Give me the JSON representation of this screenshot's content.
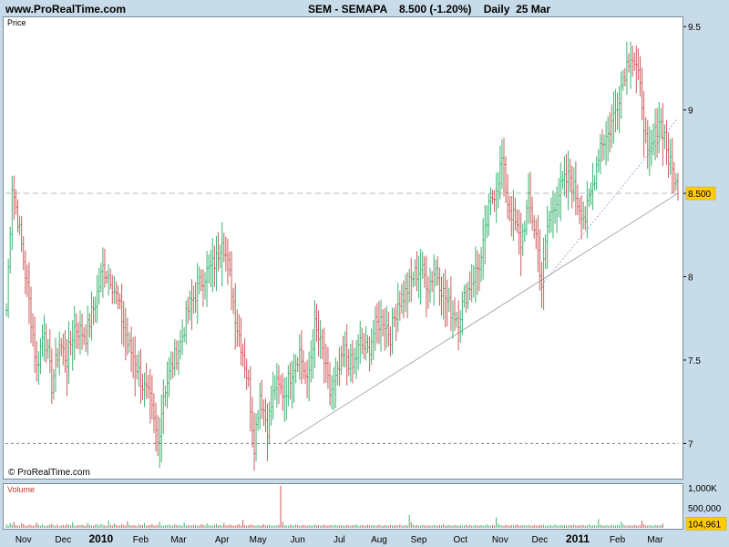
{
  "header": {
    "site": "www.ProRealTime.com",
    "ticker_line": "SEM - SEMAPA    8.500 (-1.20%)    Daily  25 Mar"
  },
  "panels": {
    "price_label": "Price",
    "volume_label": "Volume",
    "copyright": "© ProRealTime.com"
  },
  "colors": {
    "up": "#3cb371",
    "down": "#cd5c5c",
    "last_price_badge": "#ffcc00"
  },
  "chart_data": {
    "type": "bar",
    "style": "ohlc-daily",
    "last_price": 8.5,
    "last_price_label": "8.500",
    "last_change": "-1.20%",
    "ylim": [
      6.8,
      9.55
    ],
    "y_ticks": [
      {
        "value": 9.5,
        "label": "9.5"
      },
      {
        "value": 9,
        "label": "9"
      },
      {
        "value": 8.5,
        "label": "8.500"
      },
      {
        "value": 8,
        "label": "8"
      },
      {
        "value": 7.5,
        "label": "7.5"
      },
      {
        "value": 7,
        "label": "7"
      }
    ],
    "x_labels": [
      {
        "label": "Nov",
        "index": 9,
        "year": false
      },
      {
        "label": "Dec",
        "index": 30,
        "year": false
      },
      {
        "label": "2010",
        "index": 50,
        "year": true
      },
      {
        "label": "Feb",
        "index": 71,
        "year": false
      },
      {
        "label": "Mar",
        "index": 91,
        "year": false
      },
      {
        "label": "Apr",
        "index": 114,
        "year": false
      },
      {
        "label": "May",
        "index": 133,
        "year": false
      },
      {
        "label": "Jun",
        "index": 154,
        "year": false
      },
      {
        "label": "Jul",
        "index": 176,
        "year": false
      },
      {
        "label": "Aug",
        "index": 197,
        "year": false
      },
      {
        "label": "Sep",
        "index": 218,
        "year": false
      },
      {
        "label": "Oct",
        "index": 240,
        "year": false
      },
      {
        "label": "Nov",
        "index": 261,
        "year": false
      },
      {
        "label": "Dec",
        "index": 282,
        "year": false
      },
      {
        "label": "2011",
        "index": 302,
        "year": true
      },
      {
        "label": "Feb",
        "index": 323,
        "year": false
      },
      {
        "label": "Mar",
        "index": 343,
        "year": false
      }
    ],
    "anchors": [
      [
        0,
        7.8
      ],
      [
        3,
        8.55
      ],
      [
        6,
        8.35
      ],
      [
        12,
        7.85
      ],
      [
        16,
        7.45
      ],
      [
        20,
        7.7
      ],
      [
        24,
        7.35
      ],
      [
        28,
        7.6
      ],
      [
        32,
        7.5
      ],
      [
        36,
        7.7
      ],
      [
        42,
        7.65
      ],
      [
        47,
        7.85
      ],
      [
        51,
        8.05
      ],
      [
        55,
        8.0
      ],
      [
        60,
        7.8
      ],
      [
        64,
        7.6
      ],
      [
        68,
        7.5
      ],
      [
        72,
        7.35
      ],
      [
        76,
        7.25
      ],
      [
        80,
        7.0
      ],
      [
        83,
        7.3
      ],
      [
        87,
        7.45
      ],
      [
        92,
        7.6
      ],
      [
        96,
        7.8
      ],
      [
        100,
        7.9
      ],
      [
        104,
        8.0
      ],
      [
        108,
        8.05
      ],
      [
        111,
        8.1
      ],
      [
        114,
        8.25
      ],
      [
        118,
        8.0
      ],
      [
        122,
        7.7
      ],
      [
        125,
        7.55
      ],
      [
        128,
        7.35
      ],
      [
        131,
        7.0
      ],
      [
        134,
        7.3
      ],
      [
        138,
        7.1
      ],
      [
        142,
        7.35
      ],
      [
        147,
        7.3
      ],
      [
        151,
        7.45
      ],
      [
        155,
        7.55
      ],
      [
        159,
        7.35
      ],
      [
        163,
        7.7
      ],
      [
        167,
        7.55
      ],
      [
        171,
        7.3
      ],
      [
        175,
        7.4
      ],
      [
        179,
        7.55
      ],
      [
        183,
        7.45
      ],
      [
        187,
        7.6
      ],
      [
        191,
        7.55
      ],
      [
        195,
        7.7
      ],
      [
        199,
        7.75
      ],
      [
        203,
        7.65
      ],
      [
        207,
        7.85
      ],
      [
        211,
        7.9
      ],
      [
        215,
        8.0
      ],
      [
        219,
        8.05
      ],
      [
        223,
        7.95
      ],
      [
        227,
        8.05
      ],
      [
        231,
        7.9
      ],
      [
        235,
        7.8
      ],
      [
        239,
        7.75
      ],
      [
        243,
        7.9
      ],
      [
        247,
        8.0
      ],
      [
        251,
        8.1
      ],
      [
        255,
        8.4
      ],
      [
        259,
        8.55
      ],
      [
        262,
        8.7
      ],
      [
        265,
        8.45
      ],
      [
        268,
        8.35
      ],
      [
        272,
        8.2
      ],
      [
        276,
        8.45
      ],
      [
        280,
        8.25
      ],
      [
        283,
        7.95
      ],
      [
        286,
        8.3
      ],
      [
        290,
        8.45
      ],
      [
        294,
        8.55
      ],
      [
        298,
        8.6
      ],
      [
        302,
        8.45
      ],
      [
        306,
        8.35
      ],
      [
        310,
        8.55
      ],
      [
        314,
        8.8
      ],
      [
        318,
        8.85
      ],
      [
        322,
        9.0
      ],
      [
        326,
        9.2
      ],
      [
        330,
        9.35
      ],
      [
        333,
        9.25
      ],
      [
        336,
        9.05
      ],
      [
        339,
        8.7
      ],
      [
        342,
        8.8
      ],
      [
        345,
        8.95
      ],
      [
        348,
        8.85
      ],
      [
        350,
        8.7
      ],
      [
        353,
        8.6
      ],
      [
        355,
        8.5
      ]
    ],
    "volume_ticks": [
      {
        "label": "1,000K"
      },
      {
        "label": "500,000"
      }
    ],
    "last_volume_label": "104,961",
    "volume_ylim": [
      0,
      1000
    ],
    "volume_values_k": [
      90,
      60,
      120,
      80,
      150,
      70,
      60,
      55,
      110,
      90,
      60,
      50,
      80,
      70,
      55,
      60,
      130,
      75,
      60,
      90,
      50,
      45,
      70,
      80,
      100,
      60,
      55,
      85,
      40,
      60,
      70,
      55,
      90,
      75,
      60,
      140,
      60,
      50,
      70,
      65,
      80,
      55,
      60,
      120,
      70,
      60,
      55,
      80,
      90,
      60,
      100,
      75,
      60,
      55,
      180,
      70,
      60,
      110,
      75,
      55,
      60,
      90,
      70,
      60,
      160,
      80,
      55,
      70,
      60,
      50,
      85,
      70,
      65,
      120,
      55,
      60,
      70,
      90,
      60,
      55,
      75,
      150,
      60,
      55,
      70,
      65,
      80,
      60,
      55,
      90,
      70,
      60,
      75,
      55,
      130,
      60,
      70,
      55,
      60,
      80,
      70,
      55,
      60,
      90,
      75,
      60,
      110,
      70,
      60,
      55,
      80,
      95,
      60,
      70,
      55,
      120,
      65,
      60,
      80,
      70,
      55,
      60,
      75,
      90,
      60,
      200,
      70,
      55,
      60,
      85,
      70,
      60,
      55,
      75,
      60,
      70,
      90,
      60,
      55,
      80,
      60,
      55,
      70,
      60,
      80,
      1050,
      150,
      70,
      60,
      55,
      80,
      65,
      60,
      90,
      70,
      55,
      60,
      75,
      60,
      55,
      70,
      60,
      55,
      85,
      60,
      70,
      55,
      60,
      75,
      60,
      55,
      70,
      65,
      60,
      80,
      55,
      60,
      70,
      60,
      55,
      75,
      60,
      55,
      70,
      60,
      90,
      55,
      60,
      70,
      60,
      55,
      75,
      60,
      65,
      70,
      55,
      60,
      80,
      60,
      55,
      70,
      60,
      55,
      75,
      60,
      55,
      70,
      60,
      85,
      60,
      55,
      70,
      60,
      320,
      140,
      80,
      60,
      70,
      55,
      60,
      75,
      60,
      55,
      70,
      60,
      55,
      80,
      60,
      55,
      70,
      60,
      90,
      55,
      60,
      70,
      60,
      55,
      75,
      60,
      55,
      70,
      60,
      55,
      80,
      60,
      70,
      55,
      60,
      75,
      60,
      55,
      70,
      60,
      55,
      90,
      60,
      55,
      70,
      60,
      260,
      100,
      70,
      60,
      55,
      80,
      60,
      55,
      70,
      65,
      60,
      90,
      55,
      60,
      70,
      60,
      55,
      75,
      60,
      55,
      80,
      60,
      55,
      70,
      60,
      75,
      55,
      60,
      70,
      60,
      55,
      80,
      60,
      55,
      70,
      60,
      75,
      55,
      60,
      70,
      60,
      85,
      60,
      55,
      70,
      60,
      75,
      55,
      60,
      90,
      60,
      55,
      70,
      60,
      220,
      80,
      60,
      55,
      70,
      60,
      55,
      75,
      60,
      55,
      70,
      60,
      150,
      90,
      60,
      55,
      70,
      60,
      55,
      75,
      60,
      55,
      70,
      180,
      90,
      60,
      55,
      70,
      60,
      55,
      75,
      60,
      55,
      70,
      105
    ]
  }
}
